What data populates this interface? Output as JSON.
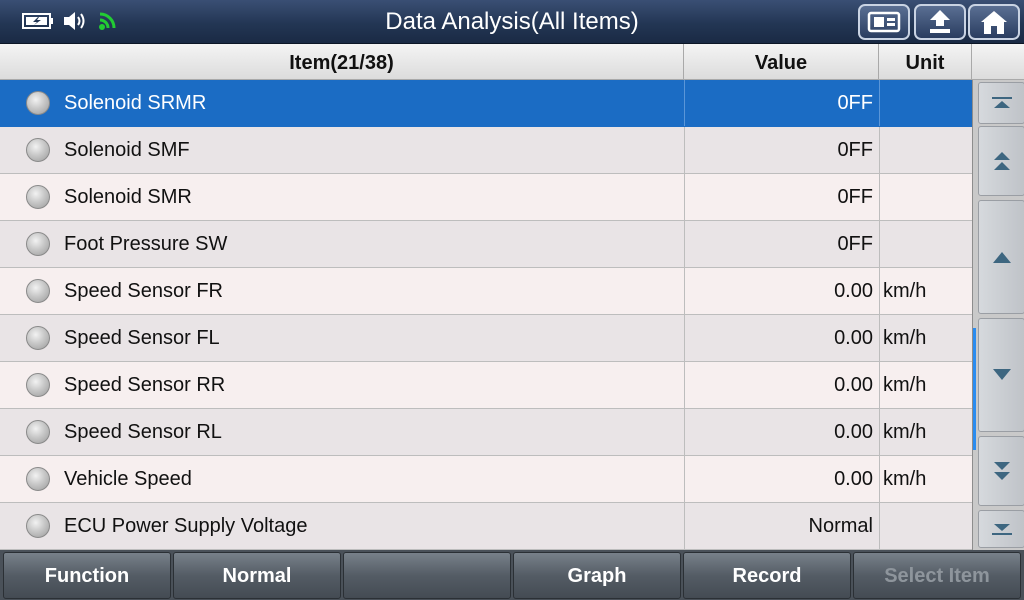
{
  "header": {
    "title": "Data Analysis(All Items)",
    "status_icons": [
      "battery-charging-icon",
      "speaker-icon",
      "wifi-icon"
    ],
    "nav_buttons": [
      "screenshot-icon",
      "back-icon",
      "home-icon"
    ]
  },
  "table": {
    "col_item": "Item(21/38)",
    "col_value": "Value",
    "col_unit": "Unit",
    "selected_row": 0,
    "rows": [
      {
        "name": "Solenoid SRMR",
        "value": "0FF",
        "unit": ""
      },
      {
        "name": "Solenoid SMF",
        "value": "0FF",
        "unit": ""
      },
      {
        "name": "Solenoid SMR",
        "value": "0FF",
        "unit": ""
      },
      {
        "name": "Foot Pressure SW",
        "value": "0FF",
        "unit": ""
      },
      {
        "name": "Speed Sensor FR",
        "value": "0.00",
        "unit": "km/h"
      },
      {
        "name": "Speed Sensor FL",
        "value": "0.00",
        "unit": "km/h"
      },
      {
        "name": "Speed Sensor RR",
        "value": "0.00",
        "unit": "km/h"
      },
      {
        "name": "Speed Sensor RL",
        "value": "0.00",
        "unit": "km/h"
      },
      {
        "name": "Vehicle Speed",
        "value": "0.00",
        "unit": "km/h"
      },
      {
        "name": "ECU Power Supply Voltage",
        "value": "Normal",
        "unit": ""
      }
    ]
  },
  "scroll_buttons": [
    "scroll-top-icon",
    "page-up-icon",
    "line-up-icon",
    "line-down-icon",
    "page-down-icon",
    "scroll-bottom-icon"
  ],
  "footer": {
    "function": "Function",
    "normal": "Normal",
    "empty": "",
    "graph": "Graph",
    "record": "Record",
    "select_item": "Select Item"
  },
  "colors": {
    "title_bar": "#233654",
    "selected_row": "#1b6cc4",
    "wifi": "#22cc33",
    "scroll_indicator": "#2a8cf0"
  }
}
